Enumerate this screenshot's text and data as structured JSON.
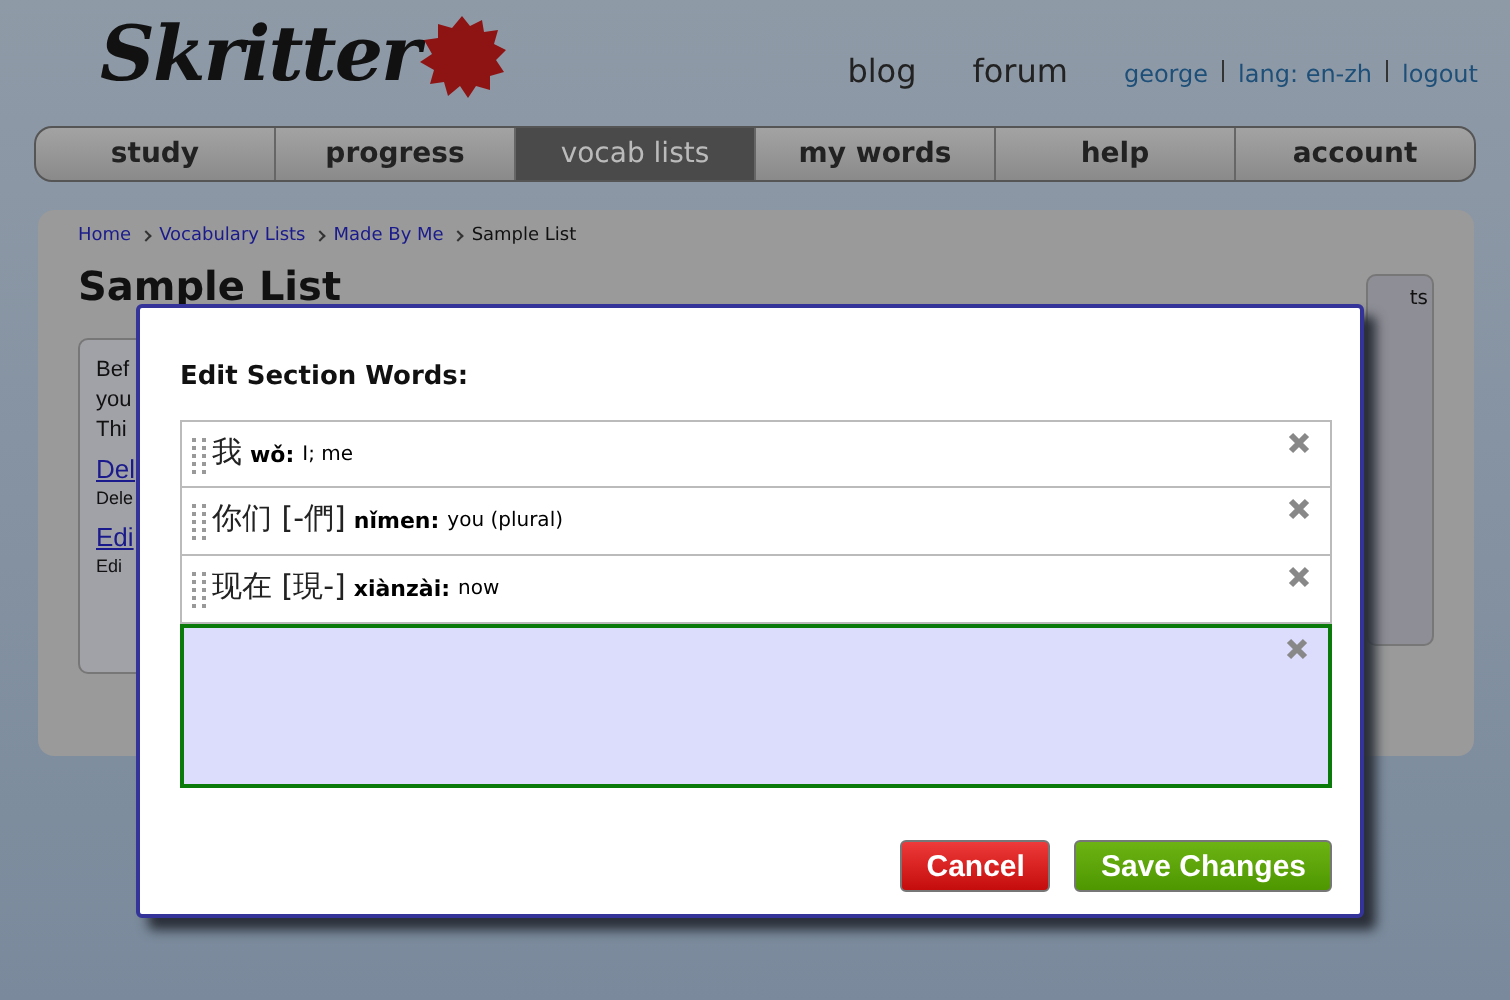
{
  "header": {
    "logo": "Skritter",
    "links": [
      "blog",
      "forum"
    ],
    "user_links": [
      "george",
      "lang: en-zh",
      "logout"
    ]
  },
  "nav": [
    {
      "label": "study",
      "selected": false
    },
    {
      "label": "progress",
      "selected": false
    },
    {
      "label": "vocab lists",
      "selected": true
    },
    {
      "label": "my words",
      "selected": false
    },
    {
      "label": "help",
      "selected": false
    },
    {
      "label": "account",
      "selected": false
    }
  ],
  "breadcrumb": [
    "Home",
    "Vocabulary Lists",
    "Made By Me"
  ],
  "breadcrumb_current": "Sample List",
  "page_title": "Sample List",
  "behind": [
    {
      "kind": "text",
      "text": "Bef"
    },
    {
      "kind": "text",
      "text": "you"
    },
    {
      "kind": "text",
      "text": "Thi"
    },
    {
      "kind": "link",
      "text": "Del"
    },
    {
      "kind": "small",
      "text": "Dele"
    },
    {
      "kind": "link",
      "text": "Edi"
    },
    {
      "kind": "small",
      "text": "Edi"
    }
  ],
  "side_box_text": "ts",
  "dialog": {
    "title": "Edit Section Words:",
    "words": [
      {
        "hanzi": "我",
        "pinyin": "wǒ:",
        "meaning": "I; me"
      },
      {
        "hanzi": "你们 [-們]",
        "pinyin": "nǐmen:",
        "meaning": "you (plural)"
      },
      {
        "hanzi": "现在 [現-]",
        "pinyin": "xiànzài:",
        "meaning": "now"
      }
    ],
    "new_entry": {
      "selected": true
    },
    "buttons": [
      {
        "kind": "cancel",
        "label": "Cancel"
      },
      {
        "kind": "save",
        "label": "Save Changes"
      }
    ]
  }
}
